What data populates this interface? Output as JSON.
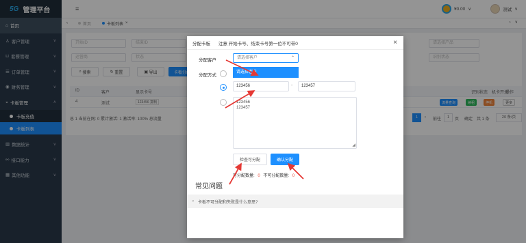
{
  "brand": {
    "logo": "5G",
    "title": "管理平台"
  },
  "sidebar": {
    "items": [
      {
        "label": "首页",
        "icon": "home-icon"
      },
      {
        "label": "客户管理",
        "icon": "users-icon"
      },
      {
        "label": "套餐管理",
        "icon": "cart-icon"
      },
      {
        "label": "订单管理",
        "icon": "list-icon"
      },
      {
        "label": "财务管理",
        "icon": "coin-icon"
      },
      {
        "label": "卡板管理",
        "icon": "card-icon"
      }
    ],
    "subitems": [
      {
        "label": "卡板充值"
      },
      {
        "label": "卡板列表"
      }
    ],
    "items2": [
      {
        "label": "数据统计",
        "icon": "chart-icon"
      },
      {
        "label": "接口能力",
        "icon": "link-icon"
      },
      {
        "label": "其他功能",
        "icon": "grid-icon"
      }
    ]
  },
  "topbar": {
    "balance": "¥0.00",
    "username": "测试"
  },
  "tabs": {
    "home": "首页",
    "current": "卡板列表"
  },
  "filters": {
    "f1": "开始ID",
    "f2": "结束ID",
    "f3": "运营商",
    "f4": "状态",
    "r1": "请选择产品",
    "r2": "识别状态",
    "search": "搜索",
    "reset": "重置",
    "export": "导出",
    "assign": "卡板分配"
  },
  "table": {
    "headers": {
      "id": "ID",
      "customer": "客户",
      "display_card": "显示卡号",
      "r_status": "识别状态",
      "sms": "机卡开关",
      "ops": "操作"
    },
    "row": {
      "id": "4",
      "customer": "测试",
      "card": "123456",
      "copy": "复制"
    },
    "tags": {
      "t1": "流量查询",
      "t2": "续租",
      "t3": "停机",
      "t4": "更多"
    }
  },
  "pagination": {
    "summary": "总 1  当前在网: 0  累计激活: 1  激活率: 100%  总流量",
    "page": "1",
    "goto": "前往",
    "goto_num": "1",
    "page_unit": "页",
    "confirm": "确定",
    "total": "共 1 条",
    "per_page": "20 条/页"
  },
  "modal": {
    "title": "分配卡板",
    "note": "注意 开始卡号、结束卡号第一位不可带0",
    "customer_label": "分配客户",
    "customer_placeholder": "请选择客户",
    "dropdown_option": "请选择客户",
    "method_label": "分配方式",
    "start_card": "123456",
    "end_card": "123457",
    "textarea_lines": [
      "123456",
      "123457"
    ],
    "check_button": "检查可分配",
    "confirm_button": "确认分配",
    "counts_prefix": "可分配数量:",
    "assignable_count": "0",
    "counts_mid": "不可分配数量:",
    "unassignable_count": "0",
    "faq_title": "常见问题",
    "faq_item": "卡板不可分配和失败是什么意思?"
  },
  "colors": {
    "primary": "#1e90ff",
    "sidebar": "#2a3a4a",
    "arrow": "#e53935"
  }
}
